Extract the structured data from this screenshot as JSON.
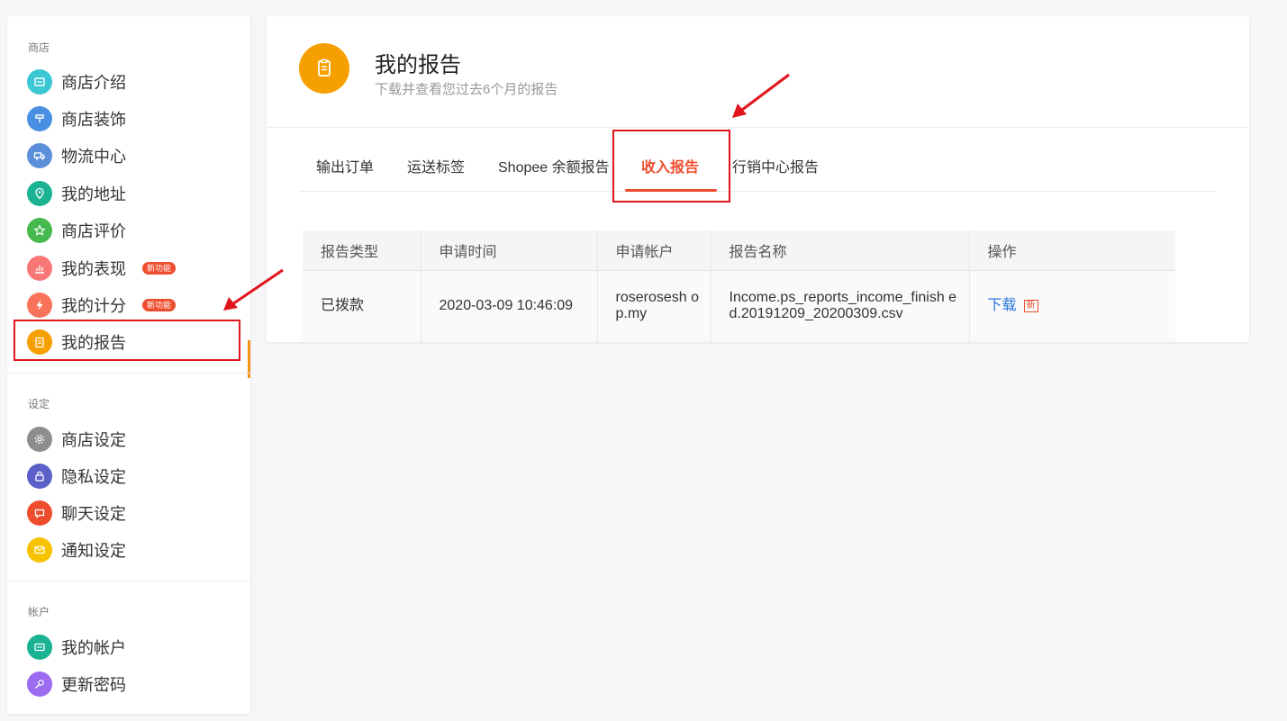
{
  "sidebar": {
    "groups": [
      {
        "title": "商店",
        "items": [
          {
            "label": "商店介绍",
            "icon": "shop-intro-icon",
            "color": "#3cc7d4"
          },
          {
            "label": "商店装饰",
            "icon": "brush-icon",
            "color": "#4a90e2"
          },
          {
            "label": "物流中心",
            "icon": "truck-icon",
            "color": "#5b8fd9"
          },
          {
            "label": "我的地址",
            "icon": "location-icon",
            "color": "#1bb394"
          },
          {
            "label": "商店评价",
            "icon": "star-icon",
            "color": "#46b94e"
          },
          {
            "label": "我的表现",
            "icon": "chart-icon",
            "color": "#f87878",
            "badge": "新功能"
          },
          {
            "label": "我的计分",
            "icon": "bolt-icon",
            "color": "#f9735b",
            "badge": "新功能"
          },
          {
            "label": "我的报告",
            "icon": "clipboard-icon",
            "color": "#f6a000",
            "active": true
          }
        ]
      },
      {
        "title": "设定",
        "items": [
          {
            "label": "商店设定",
            "icon": "gear-icon",
            "color": "#8d8d8d"
          },
          {
            "label": "隐私设定",
            "icon": "lock-icon",
            "color": "#5b5fc7"
          },
          {
            "label": "聊天设定",
            "icon": "chat-icon",
            "color": "#ee4d2d"
          },
          {
            "label": "通知设定",
            "icon": "notification-icon",
            "color": "#f7c200"
          }
        ]
      },
      {
        "title": "帐户",
        "items": [
          {
            "label": "我的帐户",
            "icon": "id-card-icon",
            "color": "#1bb394"
          },
          {
            "label": "更新密码",
            "icon": "key-icon",
            "color": "#9b6cf0"
          }
        ]
      }
    ]
  },
  "header": {
    "title": "我的报告",
    "subtitle": "下载并查看您过去6个月的报告"
  },
  "tabs": [
    {
      "label": "输出订单"
    },
    {
      "label": "运送标签"
    },
    {
      "label": "Shopee 余额报告"
    },
    {
      "label": "收入报告",
      "active": true
    },
    {
      "label": "行销中心报告"
    }
  ],
  "table": {
    "columns": [
      "报告类型",
      "申请时间",
      "申请帐户",
      "报告名称",
      "操作"
    ],
    "rows": [
      {
        "type": "已拨款",
        "time": "2020-03-09 10:46:09",
        "account": "roserosesh op.my",
        "name": "Income.ps_reports_income_finish ed.20191209_20200309.csv",
        "action": "下载",
        "action_tag": "新"
      }
    ]
  },
  "colors": {
    "accent": "#ee4d2d",
    "active_bar": "#f69113",
    "annotation_red": "#e0151d",
    "link": "#2673dd"
  }
}
